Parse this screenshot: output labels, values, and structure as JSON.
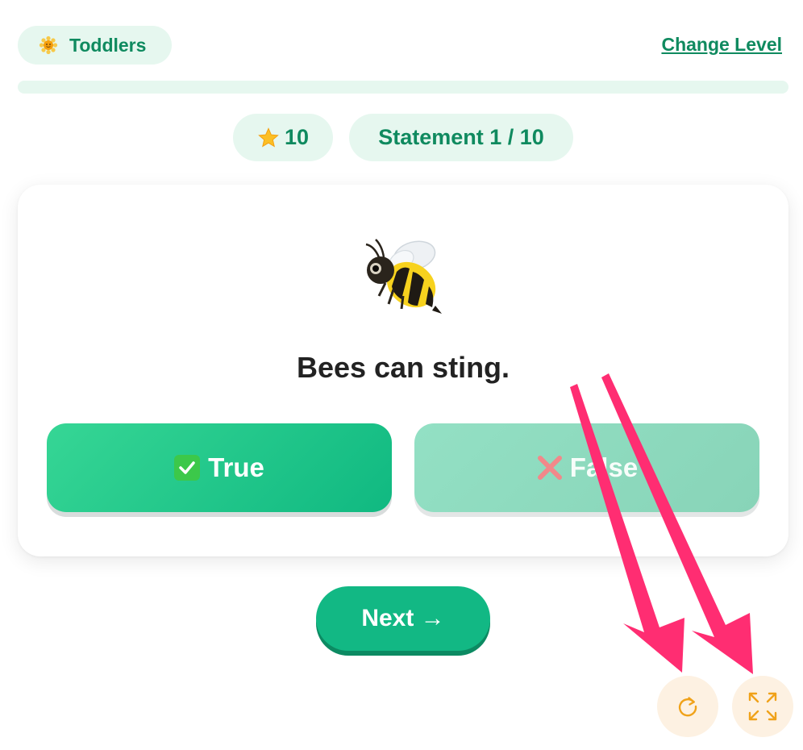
{
  "header": {
    "level_label": "Toddlers",
    "level_icon": "sun-flower-icon",
    "change_level_label": "Change Level",
    "progress": 0.0
  },
  "stats": {
    "stars_value": "10",
    "stars_icon": "star-icon",
    "statement_counter": "Statement 1 / 10"
  },
  "card": {
    "illustration": "bee-icon",
    "statement_text": "Bees can sting.",
    "true_label": "True",
    "true_icon": "check-mark-icon",
    "false_label": "False",
    "false_icon": "cross-mark-icon"
  },
  "footer": {
    "next_label": "Next →",
    "reload_icon": "reload-icon",
    "fullscreen_icon": "fullscreen-icon"
  },
  "colors": {
    "brand_green": "#0f8a5f",
    "pill_bg": "#e6f7ef",
    "true_button": "#10b981",
    "false_button": "#8dd8bc",
    "next_button": "#12b884",
    "corner_button_bg": "#fdf1e2",
    "corner_icon": "#f0a21a",
    "annotation_arrow": "#ff2d72"
  }
}
